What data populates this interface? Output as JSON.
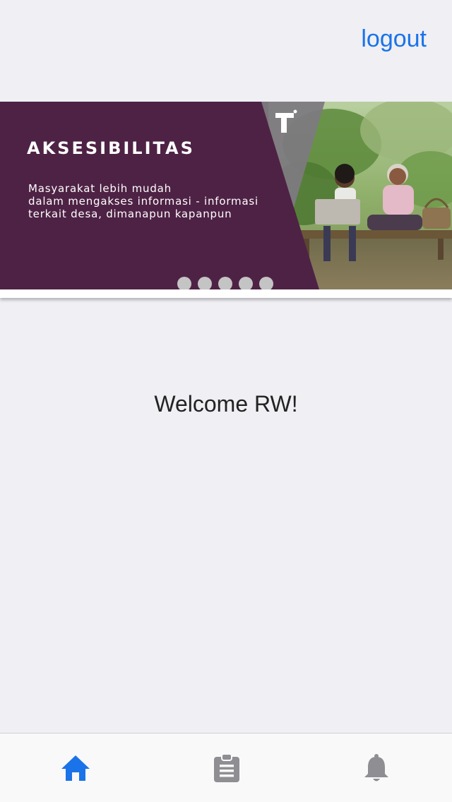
{
  "header": {
    "logout_label": "logout"
  },
  "carousel": {
    "slides": [
      {
        "title": "AKSESIBILITAS",
        "description_lines": [
          "Masyarakat lebih mudah",
          "dalam mengakses informasi - informasi",
          "terkait desa, dimanapun kapanpun"
        ]
      }
    ],
    "dot_count": 5,
    "colors": {
      "background": "#4e2245",
      "dot": "#c4c4c4"
    }
  },
  "main": {
    "welcome_text": "Welcome RW!"
  },
  "tabbar": {
    "tabs": [
      {
        "icon": "home-icon",
        "active": true
      },
      {
        "icon": "clipboard-icon",
        "active": false
      },
      {
        "icon": "bell-icon",
        "active": false
      }
    ],
    "colors": {
      "active": "#1a73e8",
      "inactive": "#8e8e93"
    }
  }
}
